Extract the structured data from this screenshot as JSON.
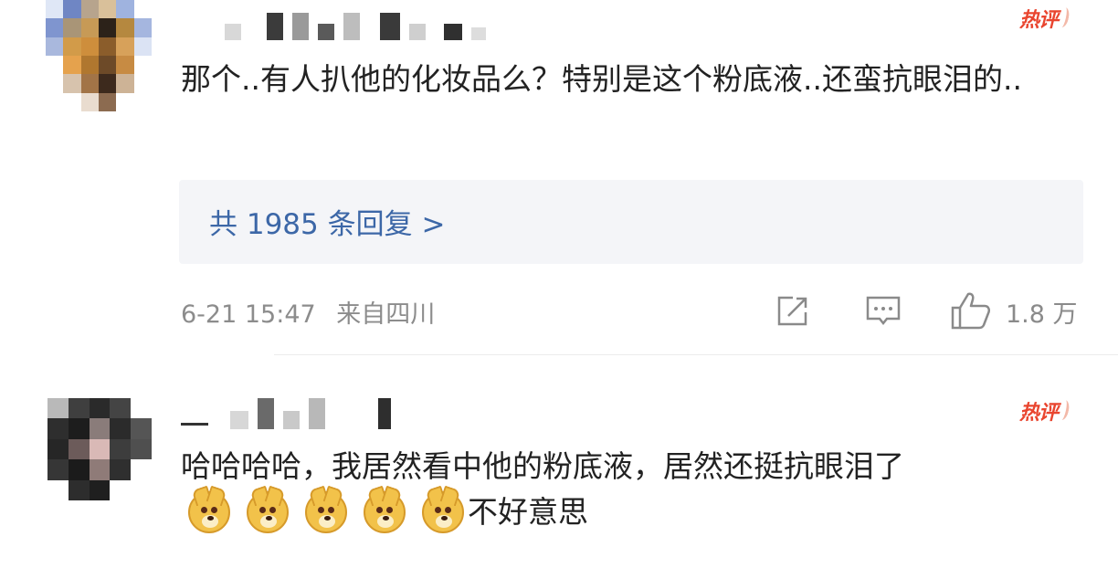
{
  "colors": {
    "hot_badge": "#e9452f",
    "reply_link": "#3c67a7",
    "meta_text": "#8c8c8c",
    "reply_background": "#f4f5f8"
  },
  "comments": [
    {
      "username": "",
      "username_obscured": true,
      "hot_badge": "热评",
      "text": "那个..有人扒他的化妆品么？特别是这个粉底液..还蛮抗眼泪的..",
      "replies_label": "共 1985 条回复 >",
      "timestamp": "6-21 15:47",
      "location": "来自四川",
      "share_icon": "share-icon",
      "comment_icon": "comment-icon",
      "like_icon": "thumbs-up-icon",
      "like_count": "1.8 万"
    },
    {
      "username": "",
      "username_obscured": true,
      "hot_badge": "热评",
      "text_before_emoji": "哈哈哈哈，我居然看中他的粉底液，居然还挺抗眼泪了",
      "emoji_name": "doge-emoji",
      "emoji_count": 5,
      "text_after_emoji": "不好意思"
    }
  ]
}
